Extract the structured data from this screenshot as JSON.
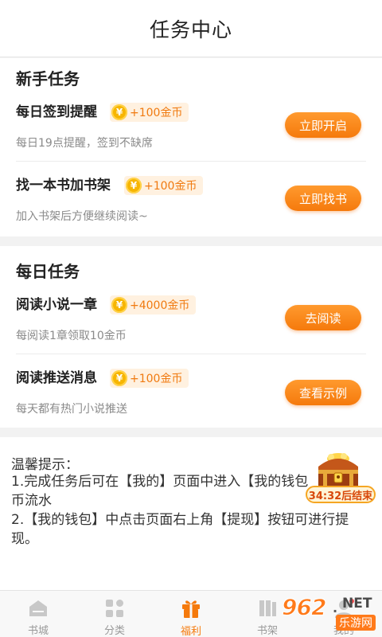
{
  "header": {
    "title": "任务中心"
  },
  "newbie": {
    "title": "新手任务",
    "tasks": [
      {
        "name": "每日签到提醒",
        "coin_symbol": "¥",
        "reward": "+100金币",
        "desc": "每日19点提醒，签到不缺席",
        "button": "立即开启"
      },
      {
        "name": "找一本书加书架",
        "coin_symbol": "¥",
        "reward": "+100金币",
        "desc": "加入书架后方便继续阅读~",
        "button": "立即找书"
      }
    ]
  },
  "daily": {
    "title": "每日任务",
    "tasks": [
      {
        "name": "阅读小说一章",
        "coin_symbol": "¥",
        "reward": "+4000金币",
        "desc": "每阅读1章领取10金币",
        "button": "去阅读"
      },
      {
        "name": "阅读推送消息",
        "coin_symbol": "¥",
        "reward": "+100金币",
        "desc": "每天都有热门小说推送",
        "button": "查看示例"
      }
    ]
  },
  "tips": {
    "title": "温馨提示：",
    "line1a": "1.完成任务后可在【我的】页面中进入【我的钱包",
    "line1b": "币流水",
    "line2a": "2.【我的钱包】中点击页面右上角【提现】按钮可进行提",
    "line2b": "现。"
  },
  "chest": {
    "timer": "34:32后结束"
  },
  "tabbar": {
    "items": [
      {
        "label": "书城",
        "icon": "bookstore-icon"
      },
      {
        "label": "分类",
        "icon": "category-icon"
      },
      {
        "label": "福利",
        "icon": "gift-icon",
        "active": true
      },
      {
        "label": "书架",
        "icon": "bookshelf-icon"
      },
      {
        "label": "我的",
        "icon": "profile-icon"
      }
    ]
  },
  "watermark": {
    "brand": "962",
    "dot": ".",
    "net": "NET",
    "sub": "乐游网"
  },
  "colors": {
    "accent": "#f57a0c",
    "reward_bg": "#fff1e0",
    "coin": "#f7b500"
  }
}
